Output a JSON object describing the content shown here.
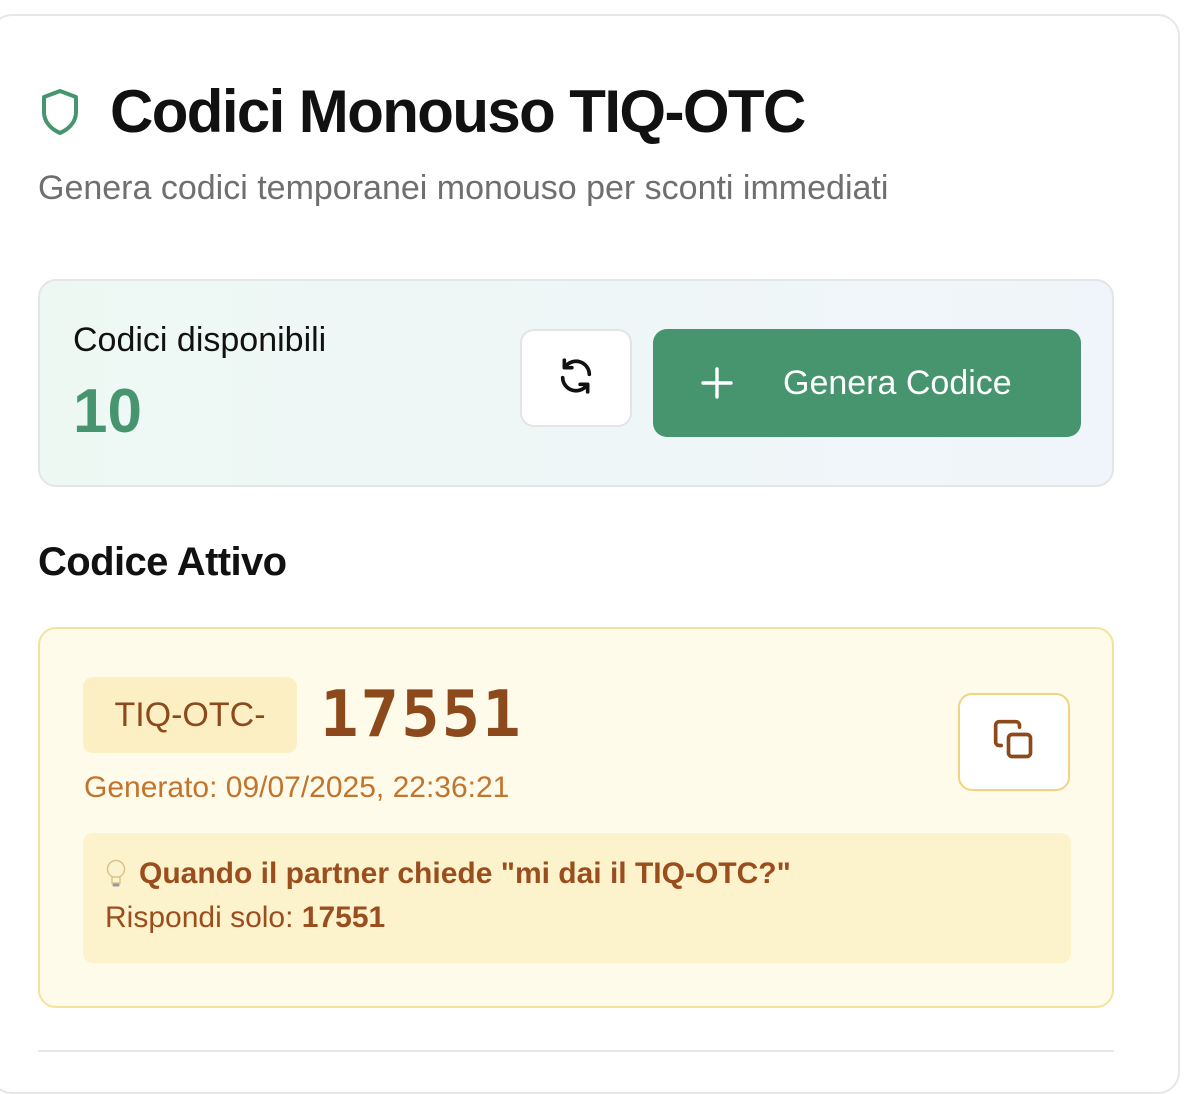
{
  "header": {
    "title": "Codici Monouso TIQ-OTC",
    "subtitle": "Genera codici temporanei monouso per sconti immediati",
    "icon": "shield-icon"
  },
  "availability": {
    "label": "Codici disponibili",
    "count": "10",
    "refresh_icon": "refresh-icon",
    "generate_label": "Genera Codice",
    "generate_icon": "plus-icon"
  },
  "active": {
    "section_title": "Codice Attivo",
    "prefix": "TIQ-OTC-",
    "code": "17551",
    "generated": "Generato: 09/07/2025, 22:36:21",
    "copy_icon": "copy-icon",
    "tip_question": "Quando il partner chiede \"mi dai il TIQ-OTC?\"",
    "tip_answer_prefix": "Rispondi solo: ",
    "tip_answer_code": "17551"
  },
  "colors": {
    "accent_green": "#46956e",
    "code_brown": "#8c4a1c",
    "generated_orange": "#c2742c",
    "active_bg": "#fefbea",
    "active_border": "#f3e39a"
  }
}
